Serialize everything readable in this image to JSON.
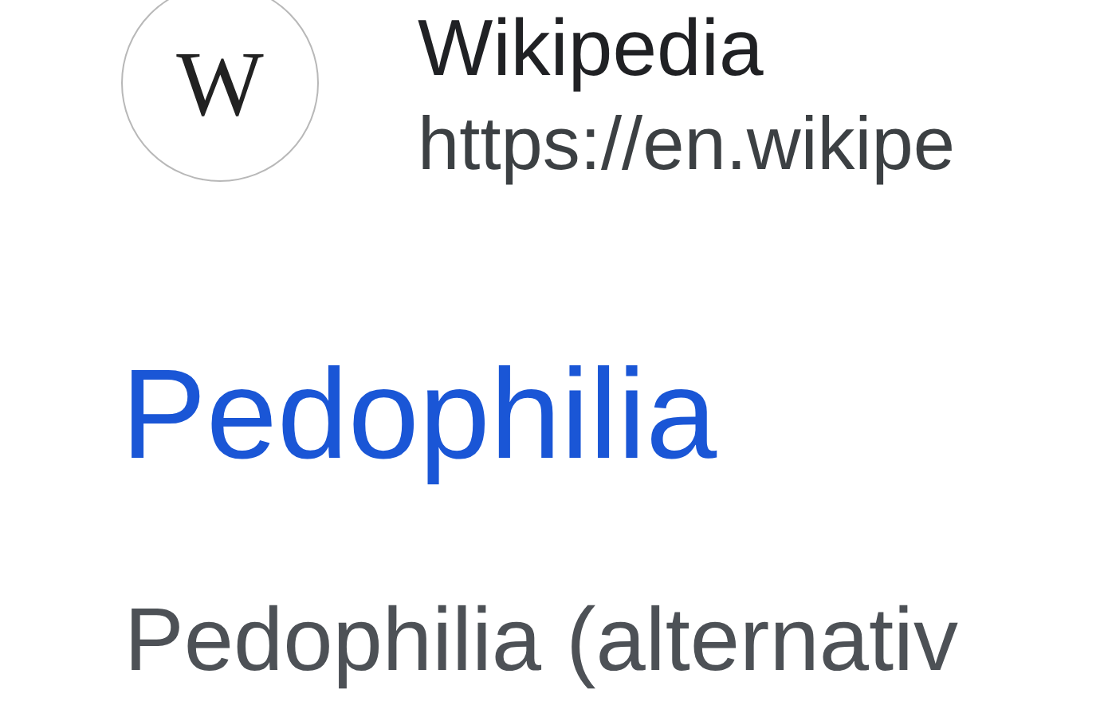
{
  "result": {
    "site": {
      "logo_text": "W",
      "name": "Wikipedia",
      "url": "https://en.wikipe"
    },
    "title": "Pedophilia",
    "snippet": "Pedophilia (alternativ"
  }
}
